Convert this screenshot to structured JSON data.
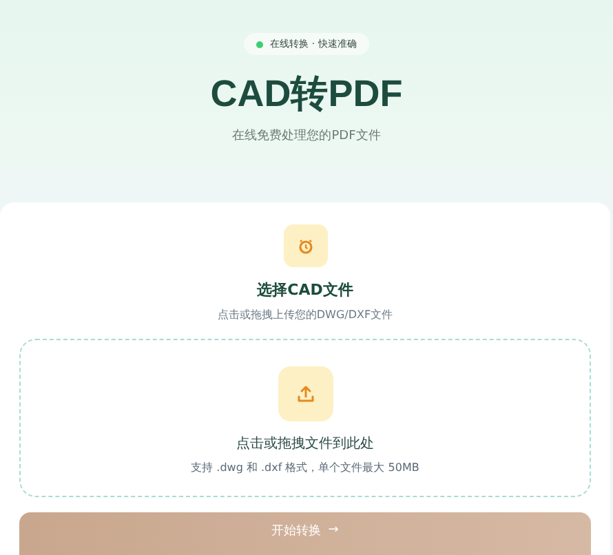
{
  "hero": {
    "badge": "在线转换 · 快速准确",
    "title": "CAD转PDF",
    "subtitle": "在线免费处理您的PDF文件"
  },
  "card": {
    "title": "选择CAD文件",
    "subtitle": "点击或拖拽上传您的DWG/DXF文件"
  },
  "dropzone": {
    "title": "点击或拖拽文件到此处",
    "hint": "支持 .dwg 和 .dxf 格式，单个文件最大 50MB"
  },
  "convert_button": {
    "label": "开始转换",
    "arrow": "→",
    "disabled": true
  }
}
